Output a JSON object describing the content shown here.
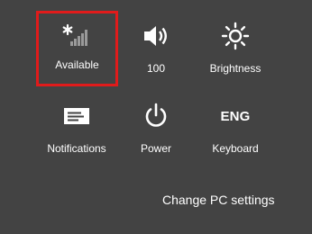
{
  "tiles": {
    "network": {
      "label": "Available",
      "icon": "wifi-signal-icon",
      "selected": true
    },
    "volume": {
      "label": "100",
      "icon": "speaker-icon"
    },
    "brightness": {
      "label": "Brightness",
      "icon": "sun-icon"
    },
    "notifications": {
      "label": "Notifications",
      "icon": "notifications-icon"
    },
    "power": {
      "label": "Power",
      "icon": "power-icon"
    },
    "keyboard": {
      "label": "Keyboard",
      "icon_text": "ENG"
    }
  },
  "footer": {
    "change_pc_settings": "Change PC settings"
  },
  "colors": {
    "background": "#434343",
    "selection_border": "#e11b1b",
    "foreground": "#ffffff",
    "dim": "#9a9a9a"
  }
}
